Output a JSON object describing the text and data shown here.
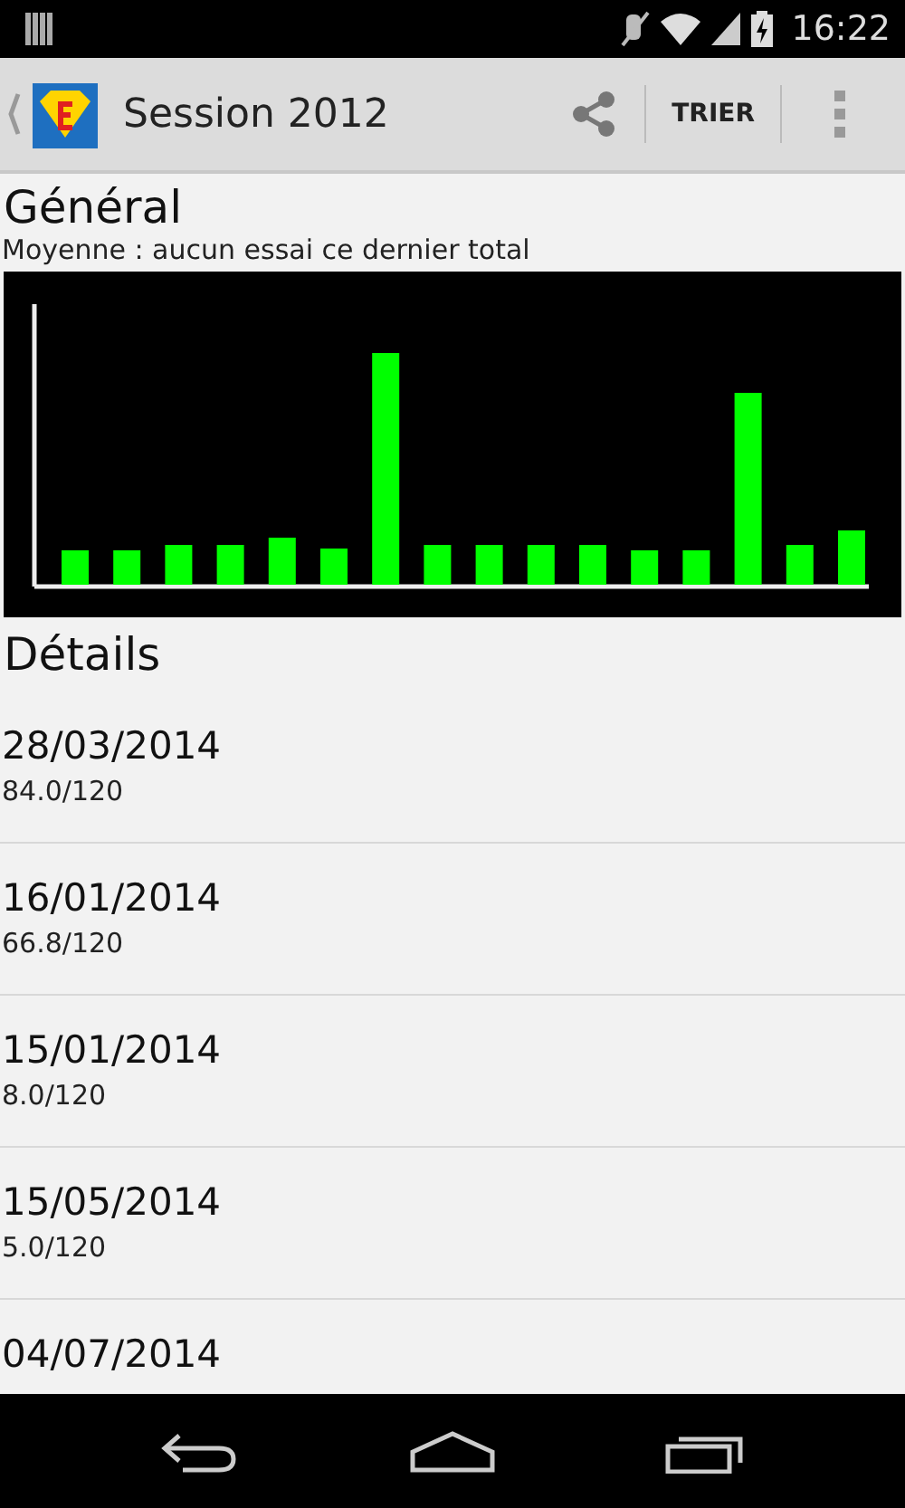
{
  "status_bar": {
    "time": "16:22"
  },
  "action_bar": {
    "title": "Session 2012",
    "sort_button": "TRIER"
  },
  "general": {
    "heading": "Général",
    "average": "Moyenne : aucun essai ce dernier total"
  },
  "details": {
    "heading": "Détails",
    "items": [
      {
        "date": "28/03/2014",
        "score": "84.0/120"
      },
      {
        "date": "16/01/2014",
        "score": "66.8/120"
      },
      {
        "date": "15/01/2014",
        "score": "8.0/120"
      },
      {
        "date": "15/05/2014",
        "score": "5.0/120"
      },
      {
        "date": "04/07/2014"
      }
    ]
  }
}
